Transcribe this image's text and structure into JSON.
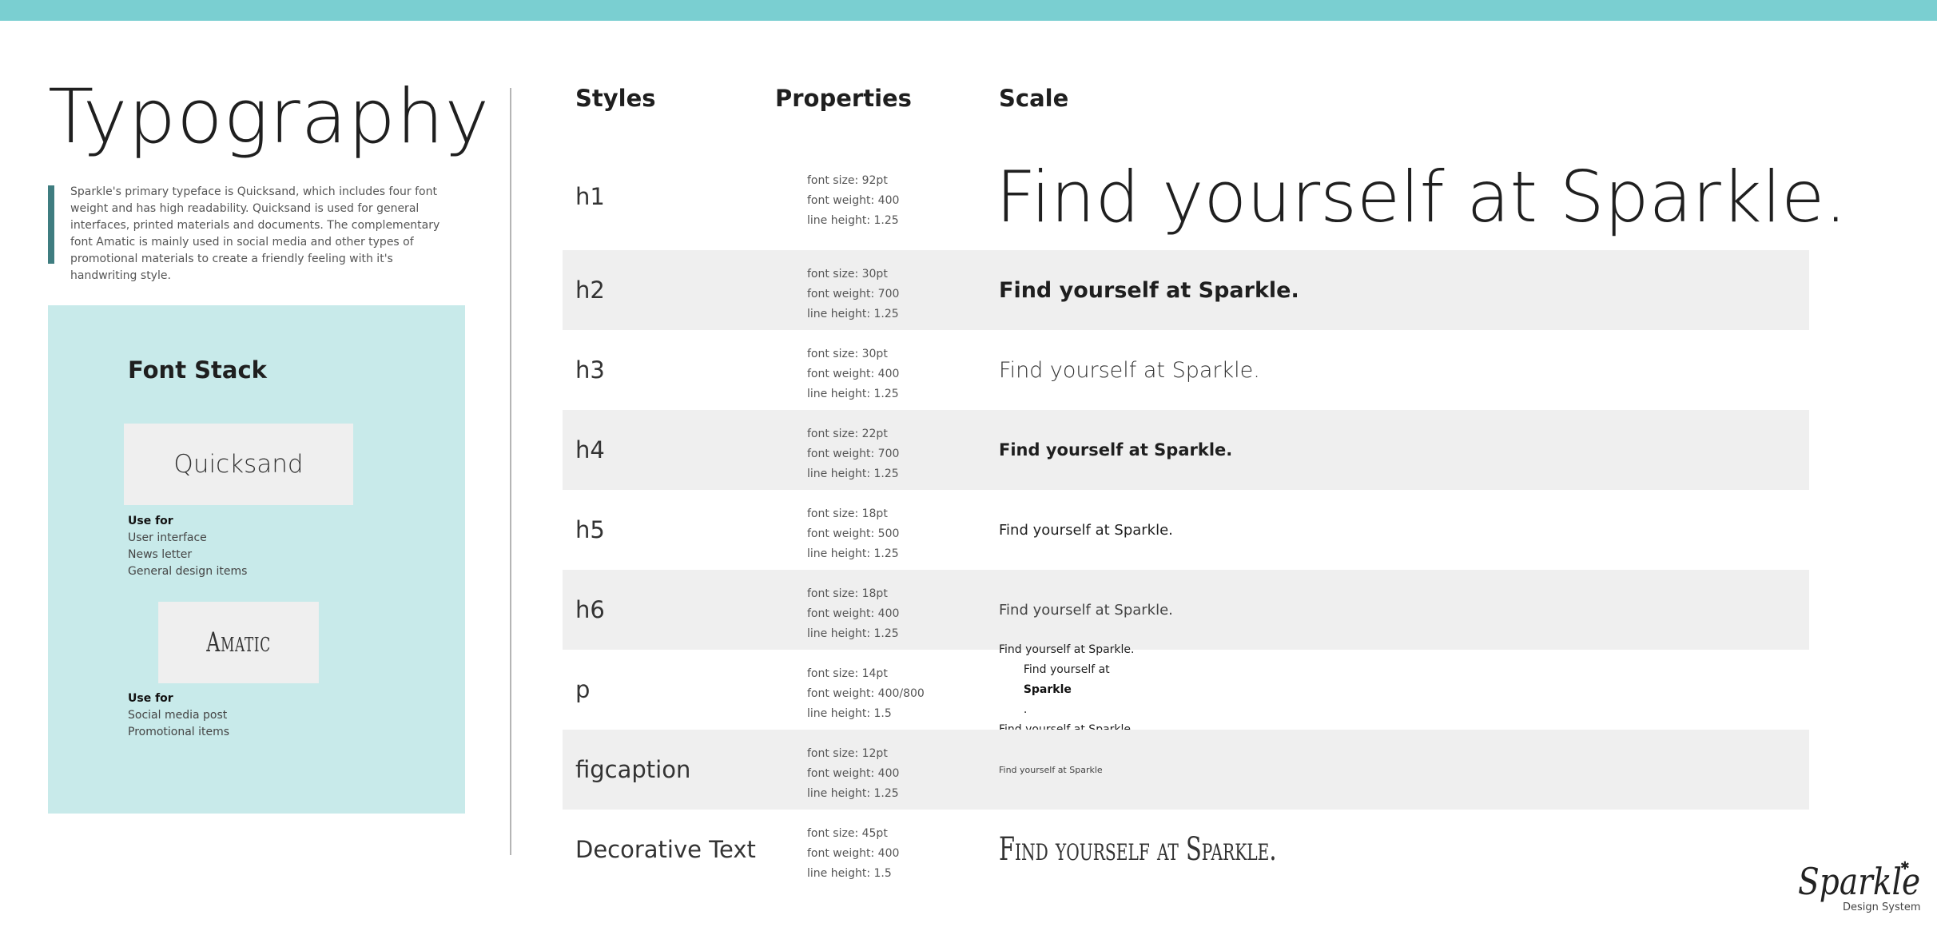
{
  "title": "Typography",
  "intro": "Sparkle's primary typeface is Quicksand, which includes four font weight and has high readability. Quicksand is used for general interfaces, printed materials and documents. The complementary font Amatic is mainly used in social media and other types of promotional materials to create a friendly feeling with it's handwriting style.",
  "font_stack": {
    "heading": "Font Stack",
    "fonts": [
      {
        "name": "Quicksand",
        "use_label": "Use for",
        "uses": [
          "User interface",
          "News letter",
          "General design items"
        ]
      },
      {
        "name": "Amatic",
        "use_label": "Use for",
        "uses": [
          "Social media post",
          "Promotional items"
        ]
      }
    ]
  },
  "columns": {
    "styles": "Styles",
    "properties": "Properties",
    "scale": "Scale"
  },
  "rows": [
    {
      "style": "h1",
      "size": "font size: 92pt",
      "weight": "font weight: 400",
      "line_height": "line height: 1.25",
      "sample": "Find yourself at Sparkle."
    },
    {
      "style": "h2",
      "size": "font size: 30pt",
      "weight": "font weight: 700",
      "line_height": "line height: 1.25",
      "sample": "Find yourself at Sparkle."
    },
    {
      "style": "h3",
      "size": "font size: 30pt",
      "weight": "font weight: 400",
      "line_height": "line height: 1.25",
      "sample": "Find yourself at Sparkle."
    },
    {
      "style": "h4",
      "size": "font size: 22pt",
      "weight": "font weight: 700",
      "line_height": "line height: 1.25",
      "sample": "Find yourself at Sparkle."
    },
    {
      "style": "h5",
      "size": "font size: 18pt",
      "weight": "font weight: 500",
      "line_height": "line height: 1.25",
      "sample": "Find yourself at Sparkle."
    },
    {
      "style": "h6",
      "size": "font size: 18pt",
      "weight": "font weight: 400",
      "line_height": "line height: 1.25",
      "sample": "Find yourself at Sparkle."
    },
    {
      "style": "p",
      "size": "font size: 14pt",
      "weight": "font weight: 400/800",
      "line_height": "line height: 1.5",
      "sample_lines": [
        "Find yourself at Sparkle.",
        "Find yourself at ",
        "Sparkle",
        ".",
        "Find yourself at Sparkle."
      ]
    },
    {
      "style": "figcaption",
      "size": "font size: 12pt",
      "weight": "font weight: 400",
      "line_height": "line height: 1.25",
      "sample": "Find yourself at Sparkle"
    },
    {
      "style": "Decorative Text",
      "size": "font size: 45pt",
      "weight": "font weight: 400",
      "line_height": "line height: 1.5",
      "sample": "Find yourself at Sparkle."
    }
  ],
  "logo": {
    "name": "Sparkle",
    "subtitle": "Design System"
  },
  "colors": {
    "accent_bar": "#7acfd1",
    "panel": "#c8eaea",
    "quote_bar": "#3f7d80",
    "row_shade": "#efefef"
  }
}
